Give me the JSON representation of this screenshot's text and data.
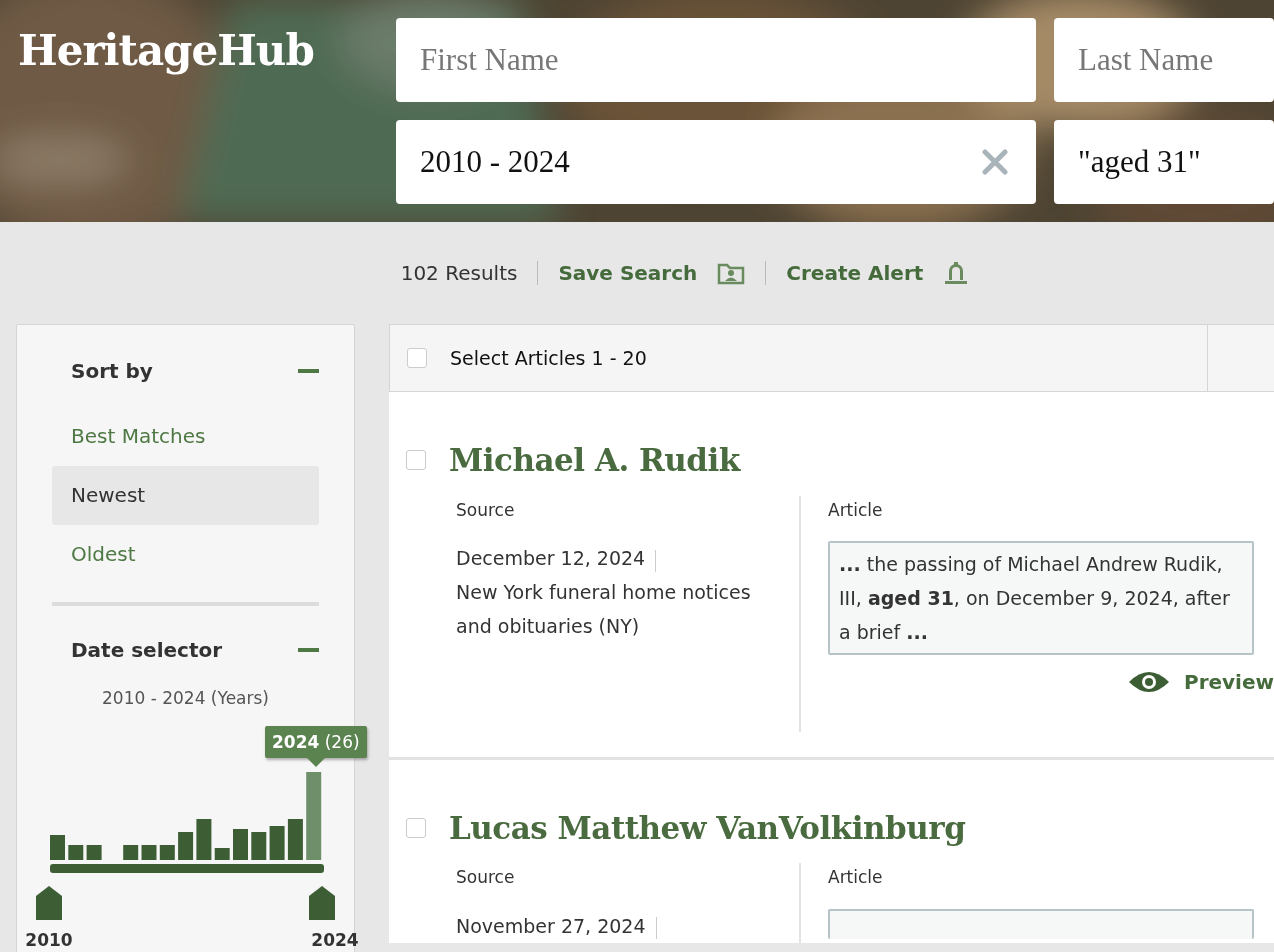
{
  "logo": "HeritageHub",
  "search": {
    "fields": [
      {
        "placeholder": "First Name"
      },
      {
        "placeholder": "Last Name"
      },
      {
        "value": "2010 - 2024",
        "clearable": true
      },
      {
        "value": "\"aged 31\"",
        "clearable": false
      }
    ]
  },
  "toolbar": {
    "result_count": "102 Results",
    "actions": [
      {
        "label": "Save Search",
        "kind": "folder"
      },
      {
        "label": "Create Alert",
        "kind": "bell"
      }
    ]
  },
  "sidebar": {
    "sort": {
      "title": "Sort by",
      "expanded": true,
      "options": [
        {
          "label": "Best Matches",
          "selected": false
        },
        {
          "label": "Newest",
          "selected": true
        },
        {
          "label": "Oldest",
          "selected": false
        }
      ]
    },
    "date_selector": {
      "title": "Date selector",
      "expanded": true,
      "range_label": "2010 - 2024 (Years)",
      "tooltip": {
        "year": "2024",
        "count": "(26)"
      },
      "start": {
        "label": "2010"
      },
      "end": {
        "label": "2024"
      }
    }
  },
  "results": {
    "select_all": {
      "label": "Select Articles 1 - 20",
      "checked": false
    },
    "items": [
      {
        "title": "Michael A. Rudik",
        "checked": false,
        "source_label": "Source",
        "date": "December 12, 2024",
        "source": "New York funeral home notices and obituaries (NY)",
        "article_label": "Article",
        "snippet": "**...** the passing of Michael Andrew Rudik, III, **aged 31**, on December 9, 2024, after a brief **...**",
        "preview": "Preview"
      },
      {
        "title": "Lucas Matthew VanVolkinburg",
        "checked": false,
        "source_label": "Source",
        "date": "November 27, 2024",
        "article_label": "Article"
      }
    ]
  }
}
